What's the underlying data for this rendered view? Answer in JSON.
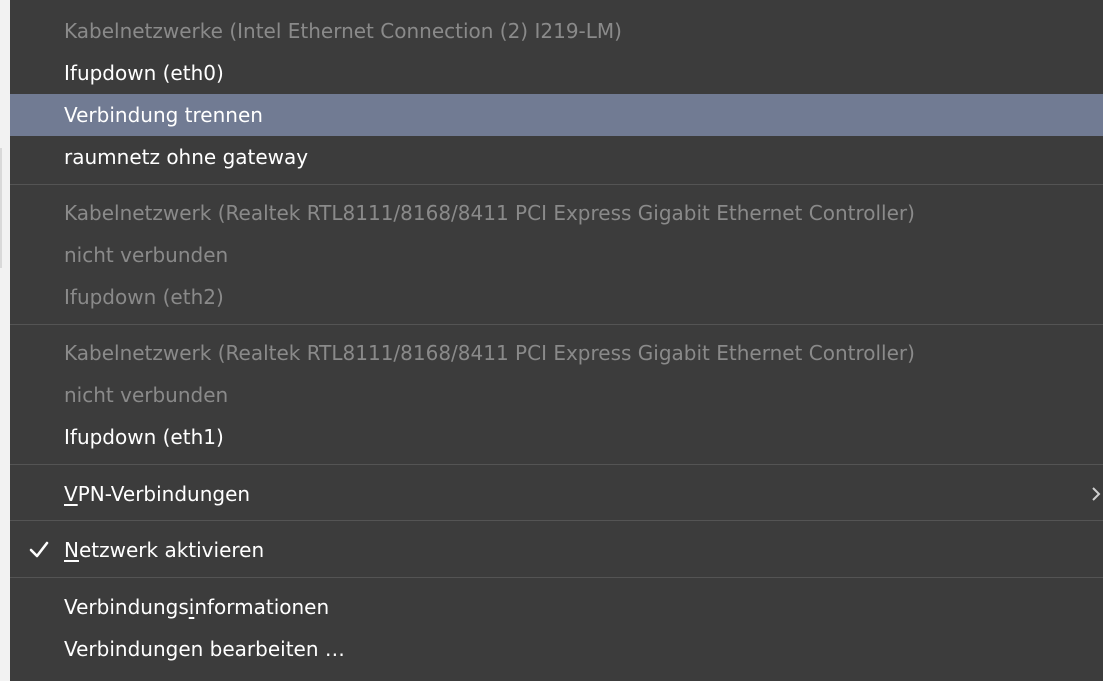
{
  "menu": {
    "wired_intel": {
      "header": "Kabelnetzwerke (Intel Ethernet Connection (2) I219-LM)",
      "items": [
        "Ifupdown (eth0)",
        "Verbindung trennen",
        "raumnetz ohne gateway"
      ]
    },
    "wired_realtek_1": {
      "header": "Kabelnetzwerk (Realtek RTL8111/8168/8411 PCI Express Gigabit Ethernet Controller)",
      "status": "nicht verbunden",
      "items": [
        "Ifupdown (eth2)"
      ]
    },
    "wired_realtek_2": {
      "header": "Kabelnetzwerk (Realtek RTL8111/8168/8411 PCI Express Gigabit Ethernet Controller)",
      "status": "nicht verbunden",
      "items": [
        "Ifupdown (eth1)"
      ]
    },
    "vpn": {
      "mnemonic": "V",
      "rest": "PN-Verbindungen",
      "arrow_icon": "chevron-right-icon"
    },
    "enable_networking": {
      "checked": true,
      "check_icon": "checkmark-icon",
      "mnemonic": "N",
      "rest": "etzwerk aktivieren"
    },
    "connection_info": {
      "before": "Verbindungs",
      "mnemonic": "i",
      "after": "nformationen"
    },
    "edit_connections": "Verbindungen bearbeiten …"
  },
  "colors": {
    "menu_background": "#3c3c3c",
    "highlight": "#717b93",
    "disabled_text": "#8a8a8a",
    "text": "#ffffff",
    "separator": "#545454"
  }
}
